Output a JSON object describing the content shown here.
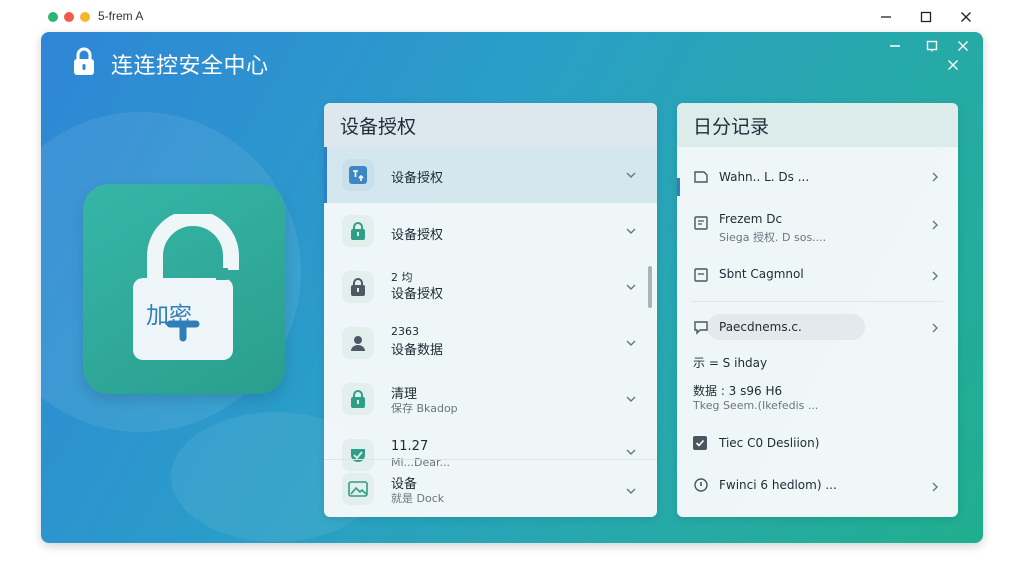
{
  "os_window": {
    "title": "5-frem A",
    "traffic_colors": [
      "#2bb673",
      "#f2594b",
      "#f7b52c"
    ]
  },
  "app": {
    "title": "连连控安全中心",
    "lock_label": "加密"
  },
  "device_panel": {
    "header": "设备授权",
    "items": [
      {
        "top": "",
        "label": "设备授权",
        "sub": "",
        "icon": "device-auth-icon"
      },
      {
        "top": "",
        "label": "设备授权",
        "sub": "",
        "icon": "lock-icon"
      },
      {
        "top": "2 均",
        "label": "设备授权",
        "sub": "",
        "icon": "lock-icon"
      },
      {
        "top": "2363",
        "label": "设备数据",
        "sub": "",
        "icon": "user-icon"
      },
      {
        "top": "",
        "label": "清理",
        "sub": "保存 Bkadop",
        "icon": "lock-icon"
      },
      {
        "top": "11.27",
        "label": "Mi...Dear...",
        "sub": "",
        "icon": "shield-check-icon"
      },
      {
        "top": "",
        "label": "设备",
        "sub": "就是 Dock",
        "icon": "image-icon"
      }
    ]
  },
  "log_panel": {
    "header": "日分记录",
    "items": [
      {
        "title": "Wahn.. L. Ds ...",
        "sub": ""
      },
      {
        "title": "Frezem Dc",
        "sub": "Siega 授权. D sos...."
      },
      {
        "title": "Sbnt Cagmnol",
        "sub": ""
      },
      {
        "title": "Paecdnems.c.",
        "sub": ""
      },
      {
        "title": "示 = S ihday",
        "sub": ""
      },
      {
        "title": "数据 : 3 s96 H6",
        "sub": "Tkeg Seem.(Ikefedis ..."
      },
      {
        "title": "Tiec C0 Desliion)",
        "sub": ""
      },
      {
        "title": "Fwinci 6 hedlom) ...",
        "sub": ""
      }
    ]
  },
  "colors": {
    "gradient_start": "#2f86d6",
    "gradient_end": "#20ae8e",
    "accent": "#2f7fc6",
    "lock_card": "#2fa99a",
    "icon_teal": "#2e9e86"
  }
}
